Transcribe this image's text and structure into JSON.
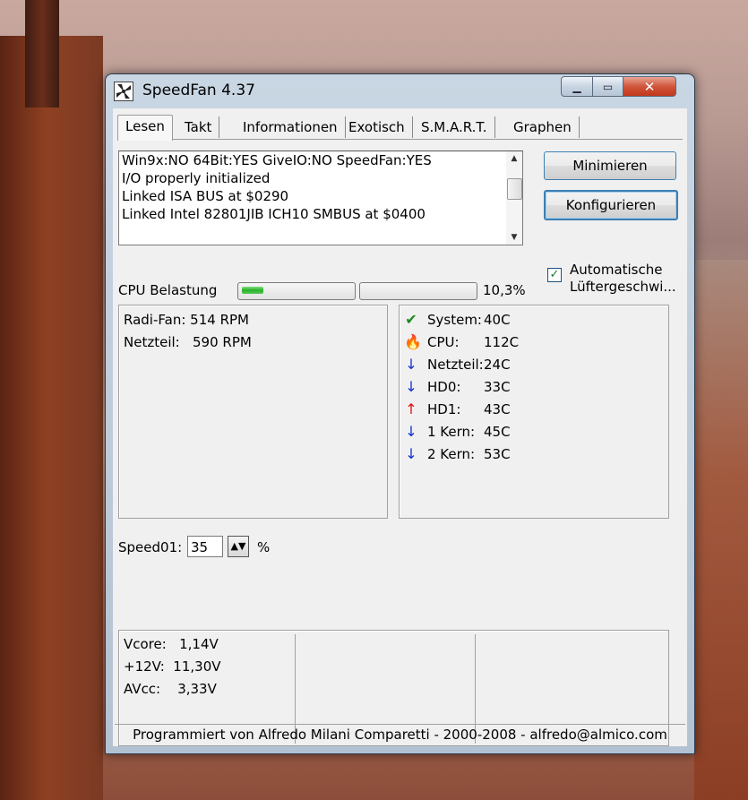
{
  "window": {
    "title": "SpeedFan 4.37",
    "controls": {
      "minimize": "minimize-icon",
      "maximize": "maximize-icon",
      "close": "close-icon"
    }
  },
  "tabs": [
    {
      "label": "Lesen",
      "active": true
    },
    {
      "label": "Takt"
    },
    {
      "label": "Informationen"
    },
    {
      "label": "Exotisch"
    },
    {
      "label": "S.M.A.R.T."
    },
    {
      "label": "Graphen"
    }
  ],
  "log": {
    "lines": [
      "Win9x:NO  64Bit:YES  GiveIO:NO  SpeedFan:YES",
      "I/O properly initialized",
      "Linked ISA BUS at $0290",
      "Linked Intel 82801JIB ICH10 SMBUS at $0400"
    ]
  },
  "buttons": {
    "minimize": "Minimieren",
    "configure": "Konfigurieren"
  },
  "auto_fan": {
    "line1": "Automatische",
    "line2": "Lüftergeschwi...",
    "checked": true
  },
  "cpu": {
    "label": "CPU Belastung",
    "value": "10,3%",
    "core_loads": [
      0.2,
      0.0
    ]
  },
  "fans": [
    {
      "name": "Radi-Fan:",
      "value": "514 RPM"
    },
    {
      "name": "Netzteil:",
      "value": "590 RPM"
    }
  ],
  "temps": [
    {
      "name": "System:",
      "value": "40C",
      "icon": "check-icon",
      "color": "#1a8a1a"
    },
    {
      "name": "CPU:",
      "value": "112C",
      "icon": "flame-icon",
      "color": "#e04010"
    },
    {
      "name": "Netzteil:",
      "value": "24C",
      "icon": "arrow-down-icon",
      "color": "#1030d0"
    },
    {
      "name": "HD0:",
      "value": "33C",
      "icon": "arrow-down-icon",
      "color": "#1030d0"
    },
    {
      "name": "HD1:",
      "value": "43C",
      "icon": "arrow-up-icon",
      "color": "#e01010"
    },
    {
      "name": "1 Kern:",
      "value": "45C",
      "icon": "arrow-down-icon",
      "color": "#1030d0"
    },
    {
      "name": "2 Kern:",
      "value": "53C",
      "icon": "arrow-down-icon",
      "color": "#1030d0"
    }
  ],
  "speed": {
    "label": "Speed01:",
    "value": "35",
    "unit": "%"
  },
  "voltages": [
    {
      "name": "Vcore:",
      "value": "1,14V"
    },
    {
      "name": "+12V:",
      "value": "11,30V"
    },
    {
      "name": "AVcc:",
      "value": "3,33V"
    }
  ],
  "status": "Programmiert von Alfredo Milani Comparetti - 2000-2008 - alfredo@almico.com"
}
